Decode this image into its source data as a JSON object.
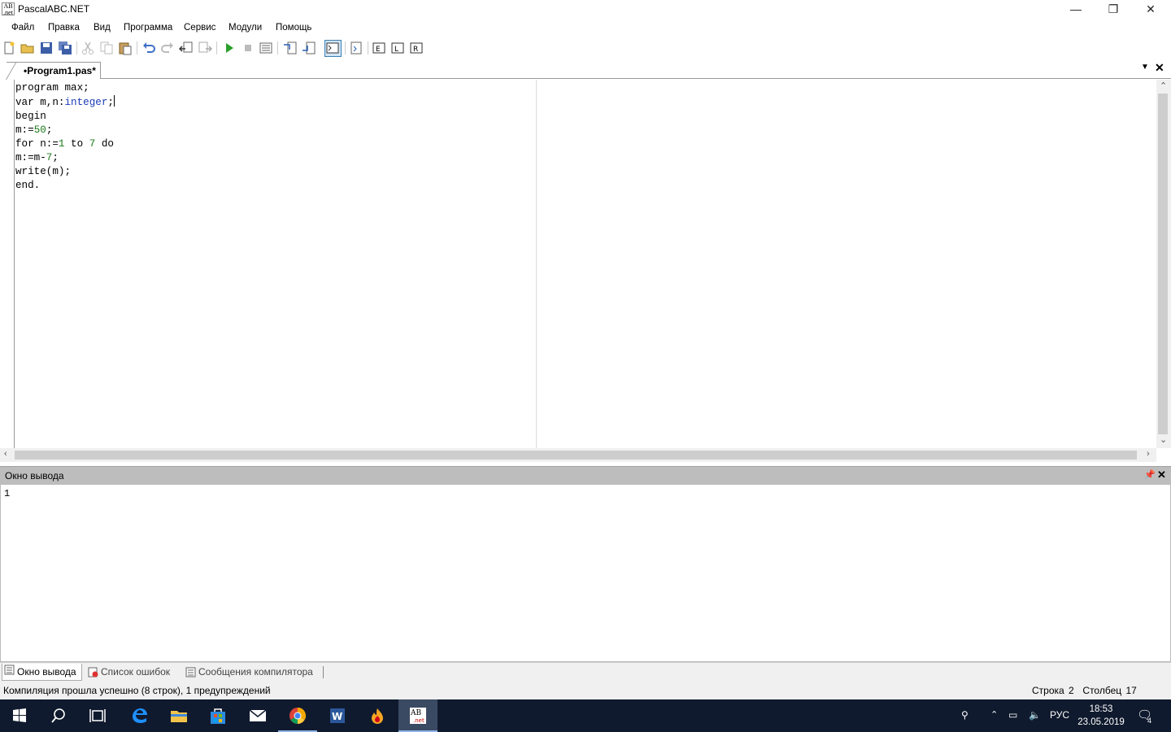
{
  "window": {
    "title": "PascalABC.NET"
  },
  "menu": [
    "Файл",
    "Правка",
    "Вид",
    "Программа",
    "Сервис",
    "Модули",
    "Помощь"
  ],
  "doc_tab": {
    "label": "•Program1.pas*"
  },
  "code_lines": [
    "program max;",
    "var m,n:integer;",
    "begin",
    "m:=50;",
    "for n:=1 to 7 do",
    "m:=m-7;",
    "write(m);",
    "end."
  ],
  "output_panel": {
    "title": "Окно вывода",
    "text": "1"
  },
  "bottom_tabs": [
    "Окно вывода",
    "Список ошибок",
    "Сообщения компилятора"
  ],
  "status": {
    "message": "Компиляция прошла успешно (8 строк), 1 предупреждений",
    "line_label": "Строка",
    "line": "2",
    "col_label": "Столбец",
    "col": "17"
  },
  "taskbar": {
    "language": "РУС",
    "time": "18:53",
    "date": "23.05.2019",
    "notifications": "4"
  },
  "colors": {
    "taskbar": "#101a2e",
    "type_keyword": "#1a3bb8",
    "number": "#1a7a1a",
    "output_header": "#bdbdbd"
  }
}
